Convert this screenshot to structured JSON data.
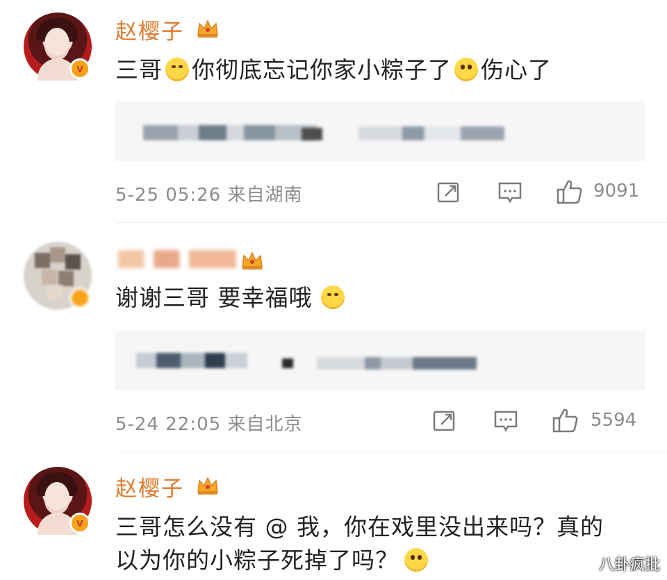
{
  "comments": [
    {
      "username": "赵樱子",
      "text_parts": [
        "三哥",
        "你彻底忘记你家小粽子了",
        "伤心了"
      ],
      "meta": "5-25 05:26 来自湖南",
      "likes": "9091"
    },
    {
      "username": "",
      "text_parts": [
        "谢谢三哥 要幸福哦"
      ],
      "meta": "5-24 22:05 来自北京",
      "likes": "5594"
    },
    {
      "username": "赵樱子",
      "line1": "三哥怎么没有 @ 我，你在戏里没出来吗？真的",
      "line2": "以为你的小粽子死掉了吗？"
    }
  ],
  "verified_badge": "v",
  "watermark": "八卦疯批",
  "colors": {
    "username": "#e07a2c",
    "meta": "#8c8c8c",
    "badge": "#f7a21b"
  },
  "icons": [
    "crown-icon",
    "repost-icon",
    "comment-icon",
    "like-icon",
    "smile-emoji",
    "sad-emoji",
    "hug-emoji"
  ]
}
